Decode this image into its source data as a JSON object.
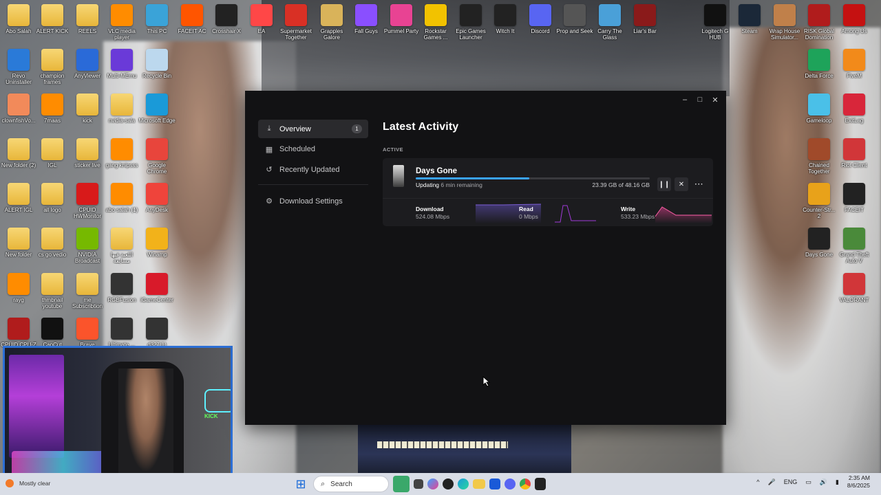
{
  "desktop": {
    "icons": [
      {
        "label": "Abo Salah",
        "icon": "folder-icon",
        "color": "#e8b63a"
      },
      {
        "label": "ALERT KICK",
        "icon": "folder-icon",
        "color": "#e8b63a"
      },
      {
        "label": "REELS",
        "icon": "folder-icon",
        "color": "#e8b63a"
      },
      {
        "label": "VLC media player",
        "icon": "vlc-icon",
        "color": "#ff8c00"
      },
      {
        "label": "This PC",
        "icon": "monitor-icon",
        "color": "#3aa3d8"
      },
      {
        "label": "FACEIT AC",
        "icon": "faceit-icon",
        "color": "#ff5500"
      },
      {
        "label": "Crosshair X",
        "icon": "crosshair-icon",
        "color": "#222222"
      },
      {
        "label": "EA",
        "icon": "ea-icon",
        "color": "#ff4747"
      },
      {
        "label": "Supermarket Together",
        "icon": "supermarket-icon",
        "color": "#d93025"
      },
      {
        "label": "Grapples Galore",
        "icon": "grapples-icon",
        "color": "#d9b35a"
      },
      {
        "label": "Fall Guys",
        "icon": "fallguys-icon",
        "color": "#8a4fff"
      },
      {
        "label": "Pummel Party",
        "icon": "pummel-icon",
        "color": "#e84393"
      },
      {
        "label": "Rockstar Games ...",
        "icon": "rockstar-icon",
        "color": "#f2c200"
      },
      {
        "label": "Epic Games Launcher",
        "icon": "epic-icon",
        "color": "#222222"
      },
      {
        "label": "Witch It",
        "icon": "epic-icon",
        "color": "#222222"
      },
      {
        "label": "Discord",
        "icon": "discord-icon",
        "color": "#5865f2"
      },
      {
        "label": "Prop and Seek",
        "icon": "prop-icon",
        "color": "#555555"
      },
      {
        "label": "Carry The Glass",
        "icon": "glass-icon",
        "color": "#4aa0d8"
      },
      {
        "label": "Liar's Bar",
        "icon": "liars-icon",
        "color": "#8a1a1a"
      },
      {
        "label": "Logitech G HUB",
        "icon": "logitech-icon",
        "color": "#111111"
      },
      {
        "label": "Steam",
        "icon": "steam-icon",
        "color": "#1b2838"
      },
      {
        "label": "Wrap House Simulator...",
        "icon": "wrap-icon",
        "color": "#c0804a"
      },
      {
        "label": "RISK Global Domination",
        "icon": "risk-icon",
        "color": "#b01c1c"
      },
      {
        "label": "Among Us",
        "icon": "amongus-icon",
        "color": "#c51111"
      },
      {
        "label": "Revo Uninstaller",
        "icon": "revo-icon",
        "color": "#2a7ad8"
      },
      {
        "label": "champion frames",
        "icon": "folder-icon",
        "color": "#e8b63a"
      },
      {
        "label": "AnyViewer",
        "icon": "anyviewer-icon",
        "color": "#2a6ad8"
      },
      {
        "label": "Multi-MEmu",
        "icon": "memu-icon",
        "color": "#6a3ad8"
      },
      {
        "label": "Recycle Bin",
        "icon": "recycle-bin-icon",
        "color": "#bcd8ee"
      },
      {
        "label": "Delta Force",
        "icon": "deltaforce-icon",
        "color": "#1ea35a"
      },
      {
        "label": "FiveM",
        "icon": "fivem-icon",
        "color": "#f28a1a"
      },
      {
        "label": "clownfishVo...",
        "icon": "clownfish-icon",
        "color": "#f28a5a"
      },
      {
        "label": "7maas",
        "icon": "vlc-icon",
        "color": "#ff8c00"
      },
      {
        "label": "kick",
        "icon": "folder-icon",
        "color": "#e8b63a"
      },
      {
        "label": "nvidia-sala",
        "icon": "folder-icon",
        "color": "#f0d58a"
      },
      {
        "label": "Microsoft Edge",
        "icon": "edge-icon",
        "color": "#1a9ad8"
      },
      {
        "label": "Gameloop",
        "icon": "gameloop-icon",
        "color": "#4ac0e8"
      },
      {
        "label": "ExitLag",
        "icon": "exitlag-icon",
        "color": "#d8263a"
      },
      {
        "label": "New folder (2)",
        "icon": "folder-icon",
        "color": "#e8b63a"
      },
      {
        "label": "IGL",
        "icon": "folder-icon",
        "color": "#2aa84a"
      },
      {
        "label": "sticker live",
        "icon": "folder-icon",
        "color": "#e8b63a"
      },
      {
        "label": "gang knipsss",
        "icon": "vlc-icon",
        "color": "#ff8c00"
      },
      {
        "label": "Google Chrome",
        "icon": "chrome-icon",
        "color": "#e8453c"
      },
      {
        "label": "Chained Together",
        "icon": "chained-icon",
        "color": "#a04a2a"
      },
      {
        "label": "Riot Client",
        "icon": "riot-icon",
        "color": "#d13639"
      },
      {
        "label": "ALERT IGL",
        "icon": "folder-icon",
        "color": "#2a3a6a"
      },
      {
        "label": "all logo",
        "icon": "folder-icon",
        "color": "#e8b63a"
      },
      {
        "label": "CPUID HWMonitor",
        "icon": "hwmonitor-icon",
        "color": "#d81a1a"
      },
      {
        "label": "abo salah (1)",
        "icon": "vlc-icon",
        "color": "#ff8c00"
      },
      {
        "label": "AnyDesk",
        "icon": "anydesk-icon",
        "color": "#ef443b"
      },
      {
        "label": "Counter-Str... 2",
        "icon": "cs2-icon",
        "color": "#e8a21a"
      },
      {
        "label": "FACEIT",
        "icon": "faceit-icon",
        "color": "#222222"
      },
      {
        "label": "New folder",
        "icon": "folder-icon",
        "color": "#2a4aa8"
      },
      {
        "label": "cs go vedio",
        "icon": "folder-icon",
        "color": "#e8b63a"
      },
      {
        "label": "NVIDIA Broadcast",
        "icon": "nvidia-icon",
        "color": "#76b900"
      },
      {
        "label": "اللعبة فيها مسابقة",
        "icon": "folder-icon",
        "color": "#f0d58a"
      },
      {
        "label": "Winamp",
        "icon": "winamp-icon",
        "color": "#f2b21a"
      },
      {
        "label": "Days Gone",
        "icon": "daysgone-icon",
        "color": "#222222"
      },
      {
        "label": "Grand Theft Auto V",
        "icon": "gta-icon",
        "color": "#4a8a3a"
      },
      {
        "label": "rayg",
        "icon": "vlc-icon",
        "color": "#ff8c00"
      },
      {
        "label": "thmbnail youtube",
        "icon": "folder-icon",
        "color": "#e8b63a"
      },
      {
        "label": "me Subscribtion",
        "icon": "folder-icon",
        "color": "#e8b63a"
      },
      {
        "label": "RGBFusion",
        "icon": "rgbfusion-icon",
        "color": "#333333"
      },
      {
        "label": "iGameCenter",
        "icon": "igame-icon",
        "color": "#d81a2a"
      },
      {
        "label": "VALORANT",
        "icon": "valorant-icon",
        "color": "#d13639"
      },
      {
        "label": "CPUID CPU-Z",
        "icon": "cpuz-icon",
        "color": "#b01c1c"
      },
      {
        "label": "CapCut",
        "icon": "capcut-icon",
        "color": "#111111"
      },
      {
        "label": "Brave",
        "icon": "brave-icon",
        "color": "#fb542b"
      },
      {
        "label": "Ultimate ...",
        "icon": "ultimate-icon",
        "color": "#333333"
      },
      {
        "label": "d327(1)",
        "icon": "file-icon",
        "color": "#333333"
      }
    ]
  },
  "window": {
    "controls": {
      "minimize": "–",
      "maximize": "□",
      "close": "✕"
    },
    "nav": [
      {
        "label": "Overview",
        "badge": "1",
        "icon": "download-icon",
        "glyph": "⤓"
      },
      {
        "label": "Scheduled",
        "icon": "calendar-icon",
        "glyph": "▦"
      },
      {
        "label": "Recently Updated",
        "icon": "update-icon",
        "glyph": "↺"
      }
    ],
    "settings": {
      "label": "Download Settings",
      "glyph": "⚙"
    },
    "main": {
      "title": "Latest Activity",
      "section": "ACTIVE",
      "item": {
        "title": "Days Gone",
        "status": "Updating",
        "remaining": "6 min remaining",
        "size": "23.39 GB of 48.16 GB",
        "progress": 0.486,
        "pause": "❙❙",
        "cancel": "✕",
        "more": "···"
      },
      "stats": [
        {
          "label": "Download",
          "value": "524.08 Mbps",
          "color": "#7b5ed6"
        },
        {
          "label": "Read",
          "value": "0 Mbps",
          "color": "#a03ad8"
        },
        {
          "label": "Write",
          "value": "533.23 Mbps",
          "color": "#e84393"
        }
      ]
    }
  },
  "taskbar": {
    "weather": "Mostly clear",
    "search_placeholder": "Search",
    "start_glyph": "⊞",
    "search_glyph": "⌕",
    "lang": "ENG",
    "time": "2:35 AM",
    "date": "8/6/2025",
    "tray_chevron": "^",
    "mic": "🎤",
    "network": "▭",
    "volume": "🔊",
    "battery": "▮"
  },
  "webcam": {
    "tag": "KICK"
  }
}
